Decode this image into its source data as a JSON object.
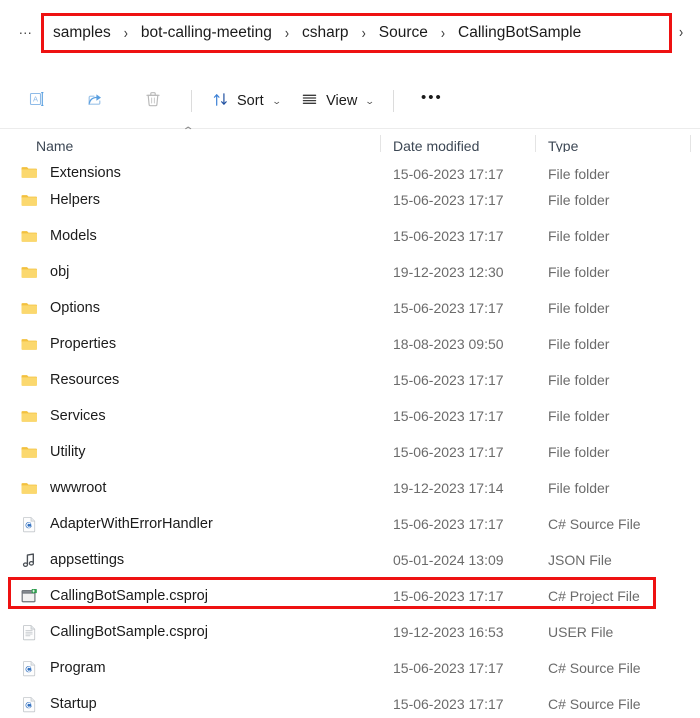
{
  "window": {
    "app": "File Explorer"
  },
  "addressbar": {
    "overflow_label": "…",
    "separator": "›",
    "trailing_separator": "›",
    "crumbs": [
      "samples",
      "bot-calling-meeting",
      "csharp",
      "Source",
      "CallingBotSample"
    ],
    "highlight_color": "#ee1111"
  },
  "commandbar": {
    "buttons": [
      {
        "label": "",
        "icon": "rename-icon",
        "name": "rename-button"
      },
      {
        "label": "",
        "icon": "share-icon",
        "name": "share-button"
      },
      {
        "label": "",
        "icon": "delete-icon",
        "name": "delete-button"
      }
    ],
    "sort_label": "Sort",
    "view_label": "View",
    "overflow_label": "•••",
    "chevron": "⌄"
  },
  "columns": {
    "name": "Name",
    "date_modified": "Date modified",
    "type": "Type",
    "sort_indicator": "⌃",
    "sort_column": "Name",
    "sort_direction": "ascending"
  },
  "files": [
    {
      "name": "Extensions",
      "date": "15-06-2023 17:17",
      "type": "File folder",
      "icon": "folder-icon",
      "clipped": true
    },
    {
      "name": "Helpers",
      "date": "15-06-2023 17:17",
      "type": "File folder",
      "icon": "folder-icon"
    },
    {
      "name": "Models",
      "date": "15-06-2023 17:17",
      "type": "File folder",
      "icon": "folder-icon"
    },
    {
      "name": "obj",
      "date": "19-12-2023 12:30",
      "type": "File folder",
      "icon": "folder-icon"
    },
    {
      "name": "Options",
      "date": "15-06-2023 17:17",
      "type": "File folder",
      "icon": "folder-icon"
    },
    {
      "name": "Properties",
      "date": "18-08-2023 09:50",
      "type": "File folder",
      "icon": "folder-icon"
    },
    {
      "name": "Resources",
      "date": "15-06-2023 17:17",
      "type": "File folder",
      "icon": "folder-icon"
    },
    {
      "name": "Services",
      "date": "15-06-2023 17:17",
      "type": "File folder",
      "icon": "folder-icon"
    },
    {
      "name": "Utility",
      "date": "15-06-2023 17:17",
      "type": "File folder",
      "icon": "folder-icon"
    },
    {
      "name": "wwwroot",
      "date": "19-12-2023 17:14",
      "type": "File folder",
      "icon": "folder-icon"
    },
    {
      "name": "AdapterWithErrorHandler",
      "date": "15-06-2023 17:17",
      "type": "C# Source File",
      "icon": "csharp-file-icon"
    },
    {
      "name": "appsettings",
      "date": "05-01-2024 13:09",
      "type": "JSON File",
      "icon": "json-file-icon"
    },
    {
      "name": "CallingBotSample.csproj",
      "date": "15-06-2023 17:17",
      "type": "C# Project File",
      "icon": "csproj-file-icon",
      "highlighted": true
    },
    {
      "name": "CallingBotSample.csproj",
      "date": "19-12-2023 16:53",
      "type": "USER File",
      "icon": "generic-file-icon"
    },
    {
      "name": "Program",
      "date": "15-06-2023 17:17",
      "type": "C# Source File",
      "icon": "csharp-file-icon"
    },
    {
      "name": "Startup",
      "date": "15-06-2023 17:17",
      "type": "C# Source File",
      "icon": "csharp-file-icon"
    }
  ],
  "colors": {
    "folder": "#fbd66a",
    "folder_dark": "#f5c33f",
    "csharp_accent": "#2f6fc0",
    "highlight": "#ee1111",
    "text": "#1b1b1b",
    "muted": "#6b6b6b"
  }
}
